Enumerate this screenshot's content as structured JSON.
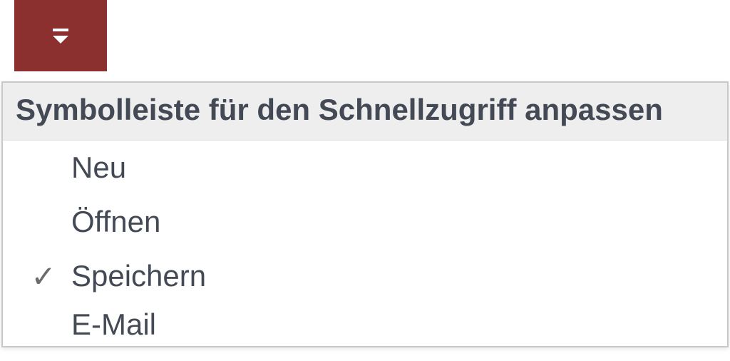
{
  "qat": {
    "header": "Symbolleiste für den Schnellzugriff anpassen",
    "items": [
      {
        "label": "Neu",
        "checked": false
      },
      {
        "label": "Öffnen",
        "checked": false
      },
      {
        "label": "Speichern",
        "checked": true
      },
      {
        "label": "E-Mail",
        "checked": false
      }
    ]
  }
}
